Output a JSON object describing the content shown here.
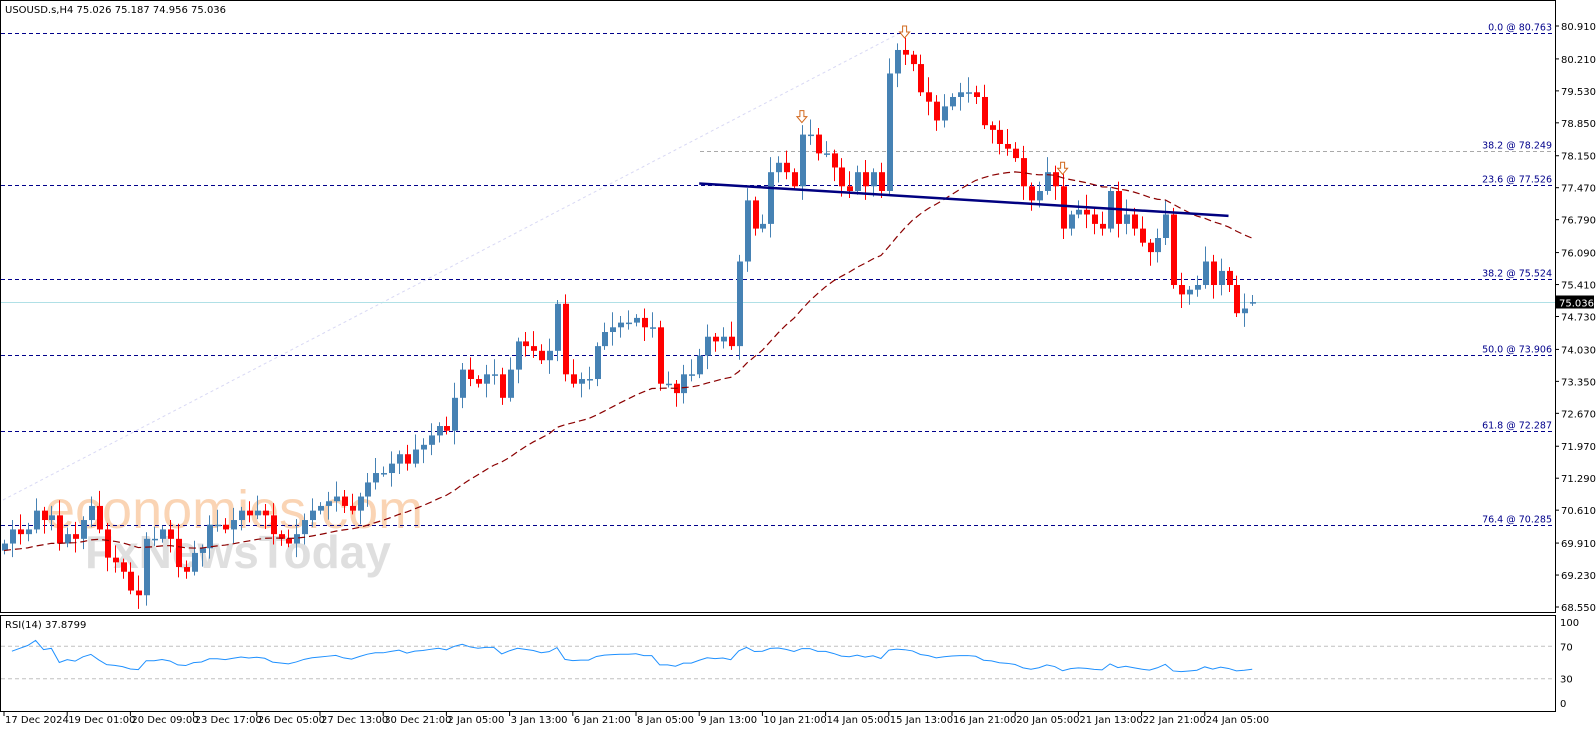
{
  "header": {
    "symbol": "USOUSD.s,H4",
    "ohlc": "75.026 75.187 74.956 75.036"
  },
  "watermark": {
    "brand1": "economies.com",
    "brand2": "FxNewsToday"
  },
  "colors": {
    "bull": "#4682B4",
    "bear": "#FF0000",
    "fib": "#00008B",
    "fib_gray": "#A9A9A9",
    "ma": "#8B0000",
    "neckline": "#000080",
    "rsi": "#1E90FF",
    "price_line": "#B0E0E6"
  },
  "chart_data": {
    "type": "candlestick",
    "timeframe": "H4",
    "ylim": [
      68.55,
      80.91
    ],
    "y_ticks": [
      "80.910",
      "80.210",
      "79.530",
      "78.850",
      "78.150",
      "77.470",
      "76.790",
      "76.090",
      "75.410",
      "74.730",
      "74.030",
      "73.350",
      "72.670",
      "71.970",
      "71.290",
      "70.610",
      "69.910",
      "69.230",
      "68.550"
    ],
    "x_ticks": [
      "17 Dec 2024",
      "19 Dec 01:00",
      "20 Dec 09:00",
      "23 Dec 17:00",
      "26 Dec 05:00",
      "27 Dec 13:00",
      "30 Dec 21:00",
      "2 Jan 05:00",
      "3 Jan 13:00",
      "6 Jan 21:00",
      "8 Jan 05:00",
      "9 Jan 13:00",
      "10 Jan 21:00",
      "14 Jan 05:00",
      "15 Jan 13:00",
      "16 Jan 21:00",
      "20 Jan 05:00",
      "21 Jan 13:00",
      "22 Jan 21:00",
      "24 Jan 05:00"
    ],
    "bars_per_tick": 8,
    "close": [
      69.9,
      70.2,
      70.1,
      70.2,
      70.6,
      70.4,
      70.5,
      69.9,
      70.1,
      70.0,
      70.4,
      70.7,
      70.2,
      69.6,
      69.5,
      69.3,
      68.9,
      68.8,
      70.0,
      70.0,
      70.2,
      70.0,
      69.4,
      69.3,
      69.7,
      69.8,
      70.3,
      70.3,
      70.2,
      70.4,
      70.6,
      70.5,
      70.6,
      70.5,
      70.1,
      70.0,
      69.9,
      70.1,
      70.4,
      70.6,
      70.7,
      70.8,
      70.9,
      70.7,
      70.6,
      70.9,
      71.2,
      71.4,
      71.4,
      71.6,
      71.8,
      71.6,
      71.9,
      72.0,
      72.2,
      72.4,
      72.3,
      73.0,
      73.6,
      73.4,
      73.3,
      73.5,
      73.5,
      73.0,
      73.6,
      74.2,
      74.1,
      74.0,
      73.8,
      74.0,
      75.0,
      73.5,
      73.3,
      73.4,
      73.4,
      74.1,
      74.4,
      74.5,
      74.6,
      74.6,
      74.7,
      74.5,
      74.5,
      73.3,
      73.3,
      73.1,
      73.5,
      73.5,
      73.9,
      74.3,
      74.2,
      74.3,
      74.1,
      75.9,
      77.2,
      76.6,
      76.7,
      77.8,
      78.0,
      77.8,
      77.5,
      78.6,
      78.6,
      78.2,
      78.2,
      77.9,
      77.5,
      77.4,
      77.8,
      77.5,
      77.8,
      77.4,
      79.9,
      80.4,
      80.3,
      80.1,
      79.5,
      79.3,
      78.9,
      79.2,
      79.4,
      79.5,
      79.5,
      79.4,
      78.8,
      78.7,
      78.4,
      78.3,
      78.1,
      77.5,
      77.2,
      77.4,
      77.8,
      77.5,
      76.6,
      76.9,
      77.0,
      76.9,
      76.7,
      76.6,
      77.4,
      76.7,
      76.9,
      76.6,
      76.3,
      76.1,
      76.4,
      76.9,
      75.4,
      75.2,
      75.3,
      75.4,
      75.9,
      75.4,
      75.7,
      75.4,
      74.8,
      74.9,
      75.036
    ],
    "last_bar": {
      "open": 75.026,
      "high": 75.187,
      "low": 74.956,
      "close": 75.036
    },
    "current_price": "75.036",
    "fib_levels": [
      {
        "label": "0.0 @ 80.763",
        "price": 80.763,
        "style": "blue"
      },
      {
        "label": "38.2 @ 78.249",
        "price": 78.249,
        "style": "gray"
      },
      {
        "label": "23.6 @ 77.526",
        "price": 77.526,
        "style": "blue"
      },
      {
        "label": "38.2 @ 75.524",
        "price": 75.524,
        "style": "blue"
      },
      {
        "label": "50.0 @ 73.906",
        "price": 73.906,
        "style": "blue"
      },
      {
        "label": "61.8 @ 72.287",
        "price": 72.287,
        "style": "blue"
      },
      {
        "label": "76.4 @ 70.285",
        "price": 70.285,
        "style": "blue"
      }
    ],
    "neckline": {
      "from_bar": 88,
      "from_price": 77.56,
      "to_bar": 155,
      "to_price": 76.87
    },
    "arrows_at_bars": [
      101,
      114,
      134
    ],
    "rsi": {
      "label": "RSI(14) 37.8799",
      "period": 14,
      "levels": [
        70,
        30
      ],
      "ticks": [
        "100",
        "70",
        "30",
        "0"
      ]
    }
  }
}
